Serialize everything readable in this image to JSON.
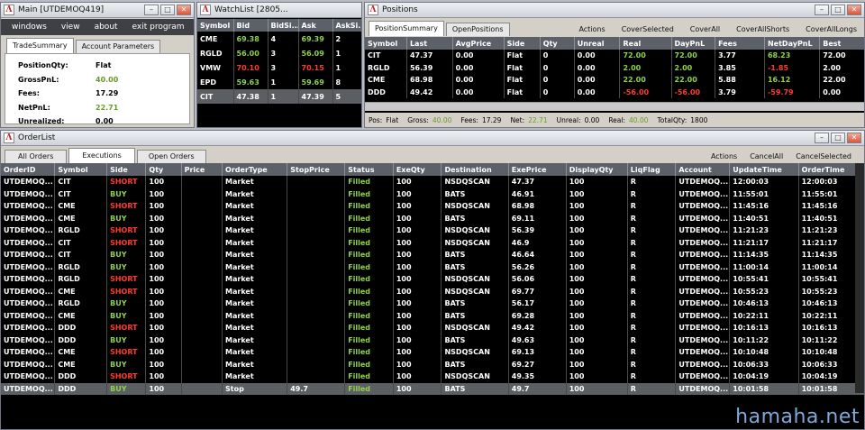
{
  "main": {
    "title": "Main [UTDEMOQ419]",
    "menu": [
      "windows",
      "view",
      "about",
      "exit program"
    ],
    "tabs": [
      "TradeSummary",
      "Account Parameters"
    ],
    "rows": [
      {
        "label": "PositionQty:",
        "value": "Flat",
        "cls": ""
      },
      {
        "label": "GrossPnL:",
        "value": "40.00",
        "cls": "gr"
      },
      {
        "label": "Fees:",
        "value": "17.29",
        "cls": ""
      },
      {
        "label": "NetPnL:",
        "value": "22.71",
        "cls": "gr"
      },
      {
        "label": "Unrealized:",
        "value": "0.00",
        "cls": ""
      }
    ]
  },
  "watch": {
    "title": "WatchList [2805...",
    "cols": [
      "Symbol",
      "Bid",
      "BidSi...",
      "Ask",
      "AskSi..."
    ],
    "rows": [
      [
        "CME",
        "69.38",
        "4",
        "69.39",
        "2"
      ],
      [
        "RGLD",
        "56.00",
        "3",
        "56.09",
        "1"
      ],
      [
        "VMW",
        "70.10",
        "3",
        "70.15",
        "1"
      ],
      [
        "EPD",
        "59.63",
        "1",
        "59.69",
        "8"
      ],
      [
        "CIT",
        "47.38",
        "1",
        "47.39",
        "5"
      ]
    ],
    "rowcls": [
      [
        "",
        "g",
        "",
        "g",
        ""
      ],
      [
        "",
        "g",
        "",
        "g",
        ""
      ],
      [
        "",
        "r",
        "",
        "r",
        ""
      ],
      [
        "",
        "g",
        "",
        "g",
        ""
      ],
      [
        "",
        "",
        "",
        "",
        ""
      ]
    ]
  },
  "positions": {
    "title": "Positions",
    "tabs": [
      "PositionSummary",
      "OpenPositions"
    ],
    "buttons": [
      "Actions",
      "CoverSelected",
      "CoverAll",
      "CoverAllShorts",
      "CoverAllLongs"
    ],
    "cols": [
      "Symbol",
      "Last",
      "AvgPrice",
      "Side",
      "Qty",
      "Unreal",
      "Real",
      "DayPnL",
      "Fees",
      "NetDayPnL",
      "Best"
    ],
    "rows": [
      [
        "CIT",
        "47.37",
        "0.00",
        "Flat",
        "0",
        "0.00",
        "72.00",
        "72.00",
        "3.77",
        "68.23",
        "72.00"
      ],
      [
        "RGLD",
        "56.39",
        "0.00",
        "Flat",
        "0",
        "0.00",
        "2.00",
        "2.00",
        "3.85",
        "-1.85",
        "2.00"
      ],
      [
        "CME",
        "68.98",
        "0.00",
        "Flat",
        "0",
        "0.00",
        "22.00",
        "22.00",
        "5.88",
        "16.12",
        "22.00"
      ],
      [
        "DDD",
        "49.42",
        "0.00",
        "Flat",
        "0",
        "0.00",
        "-56.00",
        "-56.00",
        "3.79",
        "-59.79",
        "0.00"
      ]
    ],
    "rowcls": [
      [
        "",
        "",
        "",
        "",
        "",
        "",
        "g",
        "g",
        "",
        "g",
        ""
      ],
      [
        "",
        "",
        "",
        "",
        "",
        "",
        "g",
        "g",
        "",
        "r",
        ""
      ],
      [
        "",
        "",
        "",
        "",
        "",
        "",
        "g",
        "g",
        "",
        "g",
        ""
      ],
      [
        "",
        "",
        "",
        "",
        "",
        "",
        "r",
        "r",
        "",
        "r",
        ""
      ]
    ],
    "footer": [
      {
        "k": "Pos:",
        "v": "Flat"
      },
      {
        "k": "Gross:",
        "v": "40.00"
      },
      {
        "k": "Fees:",
        "v": "17.29"
      },
      {
        "k": "Net:",
        "v": "22.71"
      },
      {
        "k": "Unreal:",
        "v": "0.00"
      },
      {
        "k": "Real:",
        "v": "40.00"
      },
      {
        "k": "TotalQty:",
        "v": "1800"
      }
    ]
  },
  "orders": {
    "title": "OrderList",
    "tabs": [
      "All Orders",
      "Executions",
      "Open Orders"
    ],
    "buttons": [
      "Actions",
      "CancelAll",
      "CancelSelected"
    ],
    "cols": [
      "OrderID",
      "Symbol",
      "Side",
      "Qty",
      "Price",
      "OrderType",
      "StopPrice",
      "Status",
      "ExeQty",
      "Destination",
      "ExePrice",
      "DisplayQty",
      "LiqFlag",
      "Account",
      "UpdateTime",
      "OrderTime"
    ],
    "rows": [
      [
        "UTDEMOQ...",
        "CIT",
        "SHORT",
        "100",
        "",
        "Market",
        "",
        "Filled",
        "100",
        "NSDQSCAN",
        "47.37",
        "100",
        "R",
        "UTDEMOQ...",
        "12:00:03",
        "12:00:03"
      ],
      [
        "UTDEMOQ...",
        "CIT",
        "BUY",
        "100",
        "",
        "Market",
        "",
        "Filled",
        "100",
        "BATS",
        "46.91",
        "100",
        "R",
        "UTDEMOQ...",
        "11:55:01",
        "11:55:01"
      ],
      [
        "UTDEMOQ...",
        "CME",
        "SHORT",
        "100",
        "",
        "Market",
        "",
        "Filled",
        "100",
        "NSDQSCAN",
        "68.98",
        "100",
        "R",
        "UTDEMOQ...",
        "11:45:16",
        "11:45:16"
      ],
      [
        "UTDEMOQ...",
        "CME",
        "BUY",
        "100",
        "",
        "Market",
        "",
        "Filled",
        "100",
        "BATS",
        "69.11",
        "100",
        "R",
        "UTDEMOQ...",
        "11:40:51",
        "11:40:51"
      ],
      [
        "UTDEMOQ...",
        "RGLD",
        "SHORT",
        "100",
        "",
        "Market",
        "",
        "Filled",
        "100",
        "NSDQSCAN",
        "56.39",
        "100",
        "R",
        "UTDEMOQ...",
        "11:21:23",
        "11:21:23"
      ],
      [
        "UTDEMOQ...",
        "CIT",
        "SHORT",
        "100",
        "",
        "Market",
        "",
        "Filled",
        "100",
        "NSDQSCAN",
        "46.9",
        "100",
        "R",
        "UTDEMOQ...",
        "11:21:17",
        "11:21:17"
      ],
      [
        "UTDEMOQ...",
        "CIT",
        "BUY",
        "100",
        "",
        "Market",
        "",
        "Filled",
        "100",
        "BATS",
        "46.64",
        "100",
        "R",
        "UTDEMOQ...",
        "11:14:35",
        "11:14:35"
      ],
      [
        "UTDEMOQ...",
        "RGLD",
        "BUY",
        "100",
        "",
        "Market",
        "",
        "Filled",
        "100",
        "BATS",
        "56.26",
        "100",
        "R",
        "UTDEMOQ...",
        "11:00:14",
        "11:00:14"
      ],
      [
        "UTDEMOQ...",
        "RGLD",
        "SHORT",
        "100",
        "",
        "Market",
        "",
        "Filled",
        "100",
        "NSDQSCAN",
        "56.06",
        "100",
        "R",
        "UTDEMOQ...",
        "10:55:41",
        "10:55:41"
      ],
      [
        "UTDEMOQ...",
        "CME",
        "SHORT",
        "100",
        "",
        "Market",
        "",
        "Filled",
        "100",
        "NSDQSCAN",
        "69.77",
        "100",
        "R",
        "UTDEMOQ...",
        "10:55:23",
        "10:55:23"
      ],
      [
        "UTDEMOQ...",
        "RGLD",
        "BUY",
        "100",
        "",
        "Market",
        "",
        "Filled",
        "100",
        "BATS",
        "56.17",
        "100",
        "R",
        "UTDEMOQ...",
        "10:46:13",
        "10:46:13"
      ],
      [
        "UTDEMOQ...",
        "CME",
        "BUY",
        "100",
        "",
        "Market",
        "",
        "Filled",
        "100",
        "BATS",
        "69.28",
        "100",
        "R",
        "UTDEMOQ...",
        "10:22:11",
        "10:22:11"
      ],
      [
        "UTDEMOQ...",
        "DDD",
        "SHORT",
        "100",
        "",
        "Market",
        "",
        "Filled",
        "100",
        "NSDQSCAN",
        "49.42",
        "100",
        "R",
        "UTDEMOQ...",
        "10:16:13",
        "10:16:13"
      ],
      [
        "UTDEMOQ...",
        "DDD",
        "BUY",
        "100",
        "",
        "Market",
        "",
        "Filled",
        "100",
        "BATS",
        "49.63",
        "100",
        "R",
        "UTDEMOQ...",
        "10:11:22",
        "10:11:22"
      ],
      [
        "UTDEMOQ...",
        "CME",
        "SHORT",
        "100",
        "",
        "Market",
        "",
        "Filled",
        "100",
        "NSDQSCAN",
        "69.13",
        "100",
        "R",
        "UTDEMOQ...",
        "10:10:48",
        "10:10:48"
      ],
      [
        "UTDEMOQ...",
        "CME",
        "BUY",
        "100",
        "",
        "Market",
        "",
        "Filled",
        "100",
        "BATS",
        "69.27",
        "100",
        "R",
        "UTDEMOQ...",
        "10:06:33",
        "10:06:33"
      ],
      [
        "UTDEMOQ...",
        "DDD",
        "SHORT",
        "100",
        "",
        "Market",
        "",
        "Filled",
        "100",
        "NSDQSCAN",
        "49.35",
        "100",
        "R",
        "UTDEMOQ...",
        "10:04:19",
        "10:04:19"
      ],
      [
        "UTDEMOQ...",
        "DDD",
        "BUY",
        "100",
        "",
        "Stop",
        "49.7",
        "Filled",
        "100",
        "BATS",
        "49.7",
        "100",
        "R",
        "UTDEMOQ...",
        "10:01:58",
        "10:01:58"
      ]
    ]
  },
  "watermark": "hamaha.net",
  "colors": {
    "green": "#8fd34d",
    "red": "#ff3b2f",
    "gain": "#6a9a2a"
  }
}
